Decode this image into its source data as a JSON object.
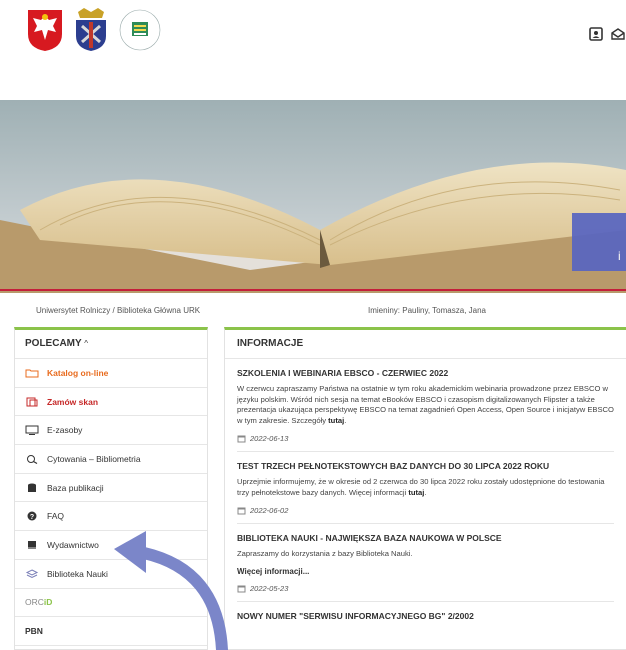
{
  "header": {
    "icons": [
      "contact-card-icon",
      "mail-icon"
    ]
  },
  "breadcrumb": {
    "items": [
      "Uniwersytet Rolniczy",
      "Biblioteka Główna URK"
    ],
    "separator": "/"
  },
  "name_days": "Imieniny: Pauliny, Tomasza, Jana",
  "hero": {
    "overlay_letter": "i"
  },
  "sidebar": {
    "title": "POLECAMY",
    "toggle": "^",
    "items": [
      {
        "label": "Katalog on-line",
        "icon": "folder-icon",
        "style": "orange"
      },
      {
        "label": "Zamów skan",
        "icon": "scan-icon",
        "style": "red"
      },
      {
        "label": "E-zasoby",
        "icon": "monitor-icon",
        "style": ""
      },
      {
        "label": "Cytowania – Bibliometria",
        "icon": "citation-icon",
        "style": ""
      },
      {
        "label": "Baza publikacji",
        "icon": "database-icon",
        "style": ""
      },
      {
        "label": "FAQ",
        "icon": "question-icon",
        "style": ""
      },
      {
        "label": "Wydawnictwo",
        "icon": "book-icon",
        "style": ""
      },
      {
        "label": "Biblioteka Nauki",
        "icon": "layers-icon",
        "style": ""
      },
      {
        "label": "ORC",
        "label_suffix": "iD",
        "icon": "",
        "style": ""
      },
      {
        "label": "PBN",
        "icon": "",
        "style": "bold"
      }
    ]
  },
  "main": {
    "title": "INFORMACJE",
    "news": [
      {
        "title": "SZKOLENIA I WEBINARIA EBSCO - CZERWIEC 2022",
        "body": "W czerwcu zapraszamy Państwa na ostatnie w tym roku akademickim webinaria prowadzone przez EBSCO w języku polskim. Wśród nich sesja na temat eBooków EBSCO i czasopism digitalizowanych Flipster a także prezentacja ukazująca perspektywę EBSCO na temat zagadnień Open Access, Open Source i inicjatyw EBSCO w tym zakresie. Szczegóły ",
        "link": "tutaj",
        "tail": ".",
        "more": "",
        "date": "2022-06-13"
      },
      {
        "title": "TEST TRZECH PEŁNOTEKSTOWYCH BAZ DANYCH DO 30 LIPCA 2022 ROKU",
        "body": "Uprzejmie informujemy, że w okresie od 2 czerwca do 30 lipca 2022 roku zostały udostępnione do testowania trzy pełnotekstowe bazy danych. Więcej informacji ",
        "link": "tutaj",
        "tail": ".",
        "more": "",
        "date": "2022-06-02"
      },
      {
        "title": "BIBLIOTEKA NAUKI - NAJWIĘKSZA BAZA NAUKOWA W POLSCE",
        "body": "Zapraszamy do korzystania z bazy Biblioteka Nauki.",
        "link": "",
        "tail": "",
        "more": "Więcej informacji...",
        "date": "2022-05-23"
      },
      {
        "title": "NOWY NUMER \"SERWISU INFORMACYJNEGO BG\" 2/2002",
        "body": "",
        "link": "",
        "tail": "",
        "more": "",
        "date": ""
      }
    ]
  },
  "colors": {
    "accent_green": "#8bc34a",
    "red": "#c62828",
    "orange": "#e86b1e",
    "arrow": "#7b86c9",
    "overlay": "#5865c1"
  }
}
